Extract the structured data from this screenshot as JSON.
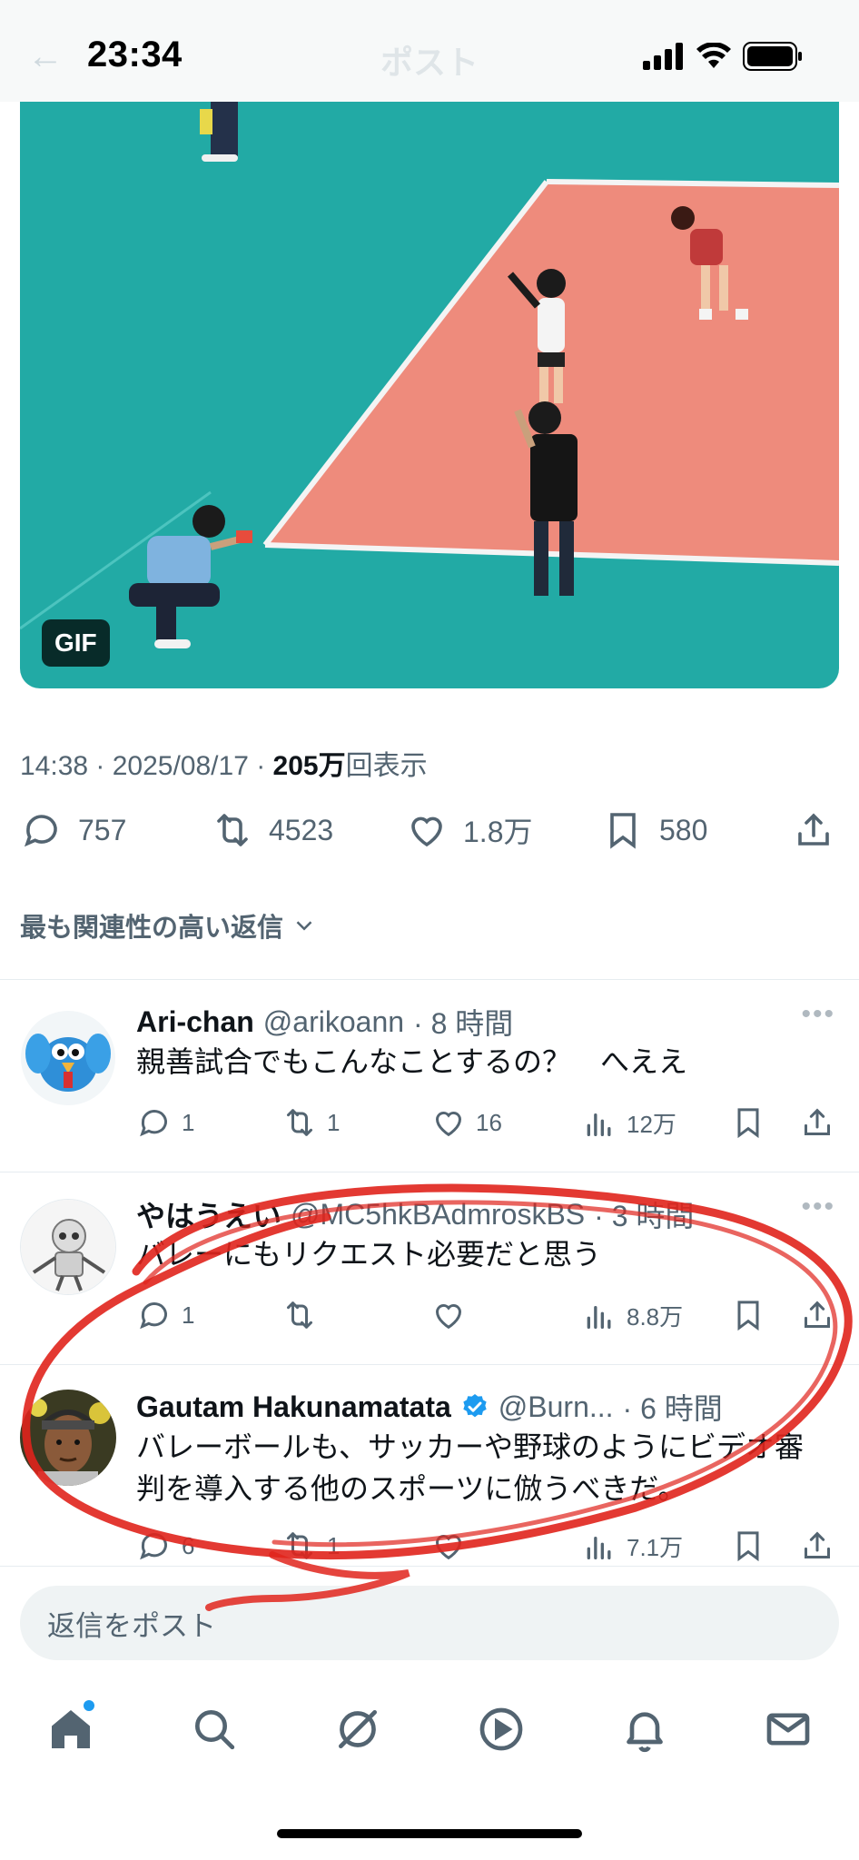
{
  "status_bar": {
    "time": "23:34"
  },
  "nav": {
    "title": "ポスト"
  },
  "media": {
    "badge": "GIF"
  },
  "post": {
    "time_date": "14:38 · 2025/08/17 · ",
    "views_count": "205万",
    "views_suffix": "回表示",
    "replies": "757",
    "reposts": "4523",
    "likes": "1.8万",
    "bookmarks": "580"
  },
  "sort": {
    "label": "最も関連性の高い返信"
  },
  "replies": [
    {
      "name": "Ari-chan",
      "handle": "@arikoann",
      "time": "· 8 時間",
      "text": "親善試合でもこんなことするの？　へええ",
      "reply_count": "1",
      "repost_count": "1",
      "like_count": "16",
      "views": "12万"
    },
    {
      "name": "やはうえい",
      "handle": "@MC5hkBAdmroskBS",
      "time": "· 3 時間",
      "text": "バレーにもリクエスト必要だと思う",
      "reply_count": "1",
      "repost_count": "",
      "like_count": "",
      "views": "8.8万"
    },
    {
      "name": "Gautam Hakunamatata",
      "handle": "@Burn...",
      "time": "· 6 時間",
      "text": "バレーボールも、サッカーや野球のようにビデオ審判を導入する他のスポーツに倣うべきだ。",
      "reply_count": "6",
      "repost_count": "1",
      "like_count": "",
      "views": "7.1万"
    }
  ],
  "composer": {
    "placeholder": "返信をポスト"
  },
  "tabs": [
    "home-icon",
    "search-icon",
    "grok-icon",
    "video-icon",
    "bell-icon",
    "mail-icon"
  ],
  "colors": {
    "accent": "#1d9bf0",
    "annotation": "#e0241c",
    "court_teal": "#1fa9a4",
    "court_salmon": "#ef8a7a"
  }
}
